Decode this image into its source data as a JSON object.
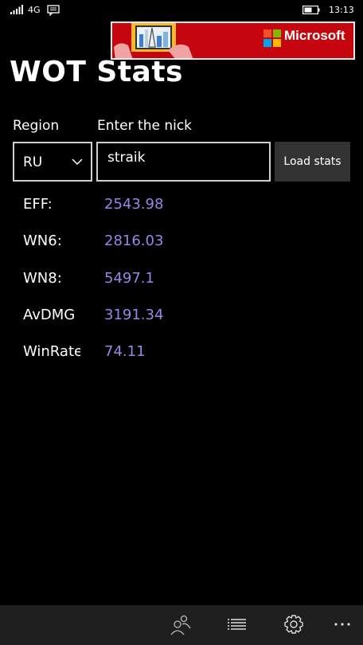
{
  "status_bar": {
    "network": "4G",
    "time": "13:13"
  },
  "ad": {
    "brand": "Microsoft",
    "colors": {
      "background": "#c5060f",
      "ms_red": "#f25022",
      "ms_green": "#7fba00",
      "ms_blue": "#00a4ef",
      "ms_yellow": "#ffb900"
    }
  },
  "title": "WOT Stats",
  "form": {
    "region_label": "Region",
    "region_value": "RU",
    "nick_label": "Enter the nick",
    "nick_value": "straik",
    "load_button": "Load stats"
  },
  "stats": [
    {
      "label": "EFF:",
      "value": "2543.98"
    },
    {
      "label": "WN6:",
      "value": "2816.03"
    },
    {
      "label": "WN8:",
      "value": "5497.1"
    },
    {
      "label": "AvDMG",
      "value": "3191.34"
    },
    {
      "label": "WinRate",
      "value": "74.11"
    }
  ],
  "colors": {
    "value_accent": "#9b85e6",
    "app_bar": "#1f1f1f",
    "button": "#333333"
  },
  "app_bar": {
    "icons": [
      "users-icon",
      "list-icon",
      "gear-icon",
      "more-icon"
    ]
  }
}
